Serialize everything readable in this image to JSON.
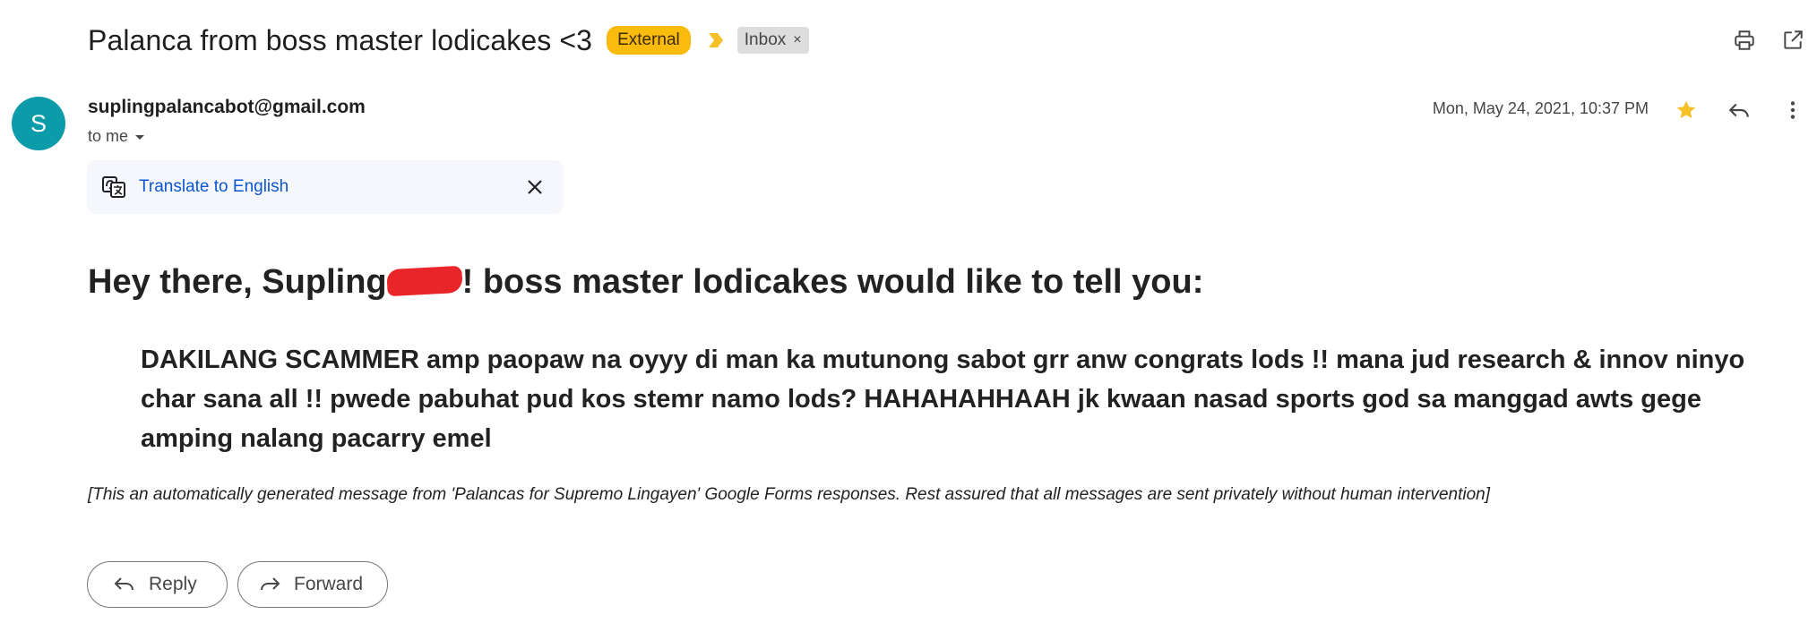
{
  "subject": {
    "title": "Palanca from boss master lodicakes <3",
    "labels": {
      "external": "External",
      "inbox": "Inbox",
      "inbox_remove": "×"
    }
  },
  "toolbar": {
    "print_icon": "print-icon",
    "open_new_window_icon": "open-in-new-window-icon"
  },
  "sender": {
    "avatar_letter": "S",
    "email": "suplingpalancabot@gmail.com",
    "to": "to me",
    "date": "Mon, May 24, 2021, 10:37 PM",
    "starred": true
  },
  "translate": {
    "link": "Translate to English"
  },
  "message": {
    "heading_before": "Hey there, Supling",
    "heading_after": "! boss master lodicakes would like to tell you:",
    "body": "DAKILANG SCAMMER amp paopaw na oyyy di man ka mutunong sabot grr anw congrats lods !! mana jud research & innov ninyo char sana all !! pwede pabuhat pud kos stemr namo lods? HAHAHAHHAAH jk kwaan nasad sports god sa manggad awts gege amping nalang pacarry emel",
    "note": "[This an automatically generated message from 'Palancas for Supremo Lingayen' Google Forms responses. Rest assured that all messages are sent privately without human intervention]"
  },
  "actions": {
    "reply": "Reply",
    "forward": "Forward"
  },
  "colors": {
    "external_badge": "#f9bb0e",
    "avatar": "#0c9ba8",
    "star": "#f6c026",
    "link": "#0b57d0",
    "redaction": "#e8262a"
  }
}
